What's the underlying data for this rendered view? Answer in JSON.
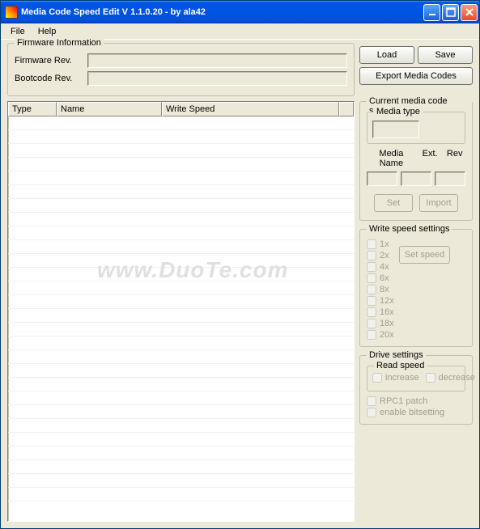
{
  "title": "Media Code Speed Edit V 1.1.0.20 - by ala42",
  "menu": {
    "file": "File",
    "help": "Help"
  },
  "firmware": {
    "legend": "Firmware Information",
    "rev_label": "Firmware Rev.",
    "rev_value": "",
    "boot_label": "Bootcode Rev.",
    "boot_value": ""
  },
  "buttons": {
    "load": "Load",
    "save": "Save",
    "export": "Export Media Codes"
  },
  "table": {
    "headers": {
      "type": "Type",
      "name": "Name",
      "speed": "Write Speed"
    },
    "rows": []
  },
  "current": {
    "legend": "Current media code setting",
    "media_type": {
      "legend": "Media type",
      "value": ""
    },
    "name_label": "Media Name",
    "ext_label": "Ext.",
    "rev_label": "Rev",
    "name_value": "",
    "ext_value": "",
    "rev_value": "",
    "set": "Set",
    "import": "Import"
  },
  "write_speed": {
    "legend": "Write speed settings",
    "speeds": [
      "1x",
      "2x",
      "4x",
      "6x",
      "8x",
      "12x",
      "16x",
      "18x",
      "20x"
    ],
    "set_speed": "Set speed"
  },
  "drive": {
    "legend": "Drive settings",
    "read_legend": "Read speed",
    "increase": "increase",
    "decrease": "decrease",
    "rpc1": "RPC1 patch",
    "bitset": "enable bitsetting"
  },
  "watermark": "www.DuoTe.com"
}
